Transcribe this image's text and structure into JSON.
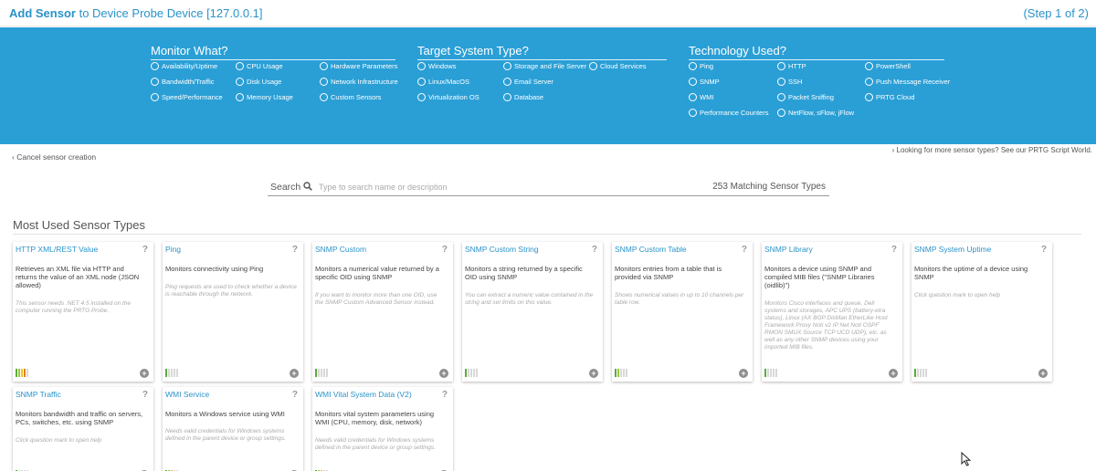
{
  "header": {
    "title_bold": "Add Sensor",
    "title_rest": "to Device",
    "device": "Probe Device [127.0.0.1]",
    "step": "(Step 1 of 2)"
  },
  "filters": {
    "monitor": {
      "title": "Monitor What?",
      "options": [
        "Availability/Uptime",
        "CPU Usage",
        "Hardware Parameters",
        "Bandwidth/Traffic",
        "Disk Usage",
        "Network Infrastructure",
        "Speed/Performance",
        "Memory Usage",
        "Custom Sensors"
      ]
    },
    "target": {
      "title": "Target System Type?",
      "options": [
        "Windows",
        "Storage and File Server",
        "Cloud Services",
        "Linux/MacOS",
        "Email Server",
        "Virtualization OS",
        "Database"
      ]
    },
    "technology": {
      "title": "Technology Used?",
      "options": [
        "Ping",
        "HTTP",
        "PowerShell",
        "SNMP",
        "SSH",
        "Push Message Receiver",
        "WMI",
        "Packet Sniffing",
        "PRTG Cloud",
        "Performance Counters",
        "NetFlow, sFlow, jFlow"
      ]
    }
  },
  "cancel_label": "Cancel sensor creation",
  "more_label": "Looking for more sensor types? See our PRTG Script World.",
  "search": {
    "label": "Search",
    "placeholder": "Type to search name or description",
    "count": "253",
    "count_label": "Matching Sensor Types"
  },
  "section_title": "Most Used Sensor Types",
  "cards": [
    {
      "name": "HTTP XML/REST Value",
      "desc": "Retrieves an XML file via HTTP and returns the value of an XML node (JSON allowed)",
      "note": "This sensor needs .NET 4.5 installed on the computer running the PRTG Probe.",
      "impact": 4
    },
    {
      "name": "Ping",
      "desc": "Monitors connectivity using Ping",
      "note": "Ping requests are used to check whether a device is reachable through the network.",
      "impact": 1
    },
    {
      "name": "SNMP Custom",
      "desc": "Monitors a numerical value returned by a specific OID using SNMP",
      "note": "If you want to monitor more than one OID, use the SNMP Custom Advanced Sensor instead.",
      "impact": 1
    },
    {
      "name": "SNMP Custom String",
      "desc": "Monitors a string returned by a specific OID using SNMP",
      "note": "You can extract a numeric value contained in the string and set limits on this value.",
      "impact": 1
    },
    {
      "name": "SNMP Custom Table",
      "desc": "Monitors entries from a table that is provided via SNMP",
      "note": "Shows numerical values in up to 10 channels per table row.",
      "impact": 2
    },
    {
      "name": "SNMP Library",
      "desc": "Monitors a device using SNMP and compiled MIB files (\"SNMP Libraries (oidlib)\")",
      "note": "Monitors Cisco interfaces and queue, Dell systems and storages, APC UPS (battery-etra status), Linux (AX BGP DisMan EtherLike Host Framework Proxy Noti v2 IP Net Noti OSPF RMON SMUX Source TCP UCD UDP), etc. as well as any other SNMP devices using your imported MIB files.",
      "impact": 1
    },
    {
      "name": "SNMP System Uptime",
      "desc": "Monitors the uptime of a device using SNMP",
      "note": "Click question mark to open help",
      "impact": 1
    },
    {
      "name": "SNMP Traffic",
      "desc": "Monitors bandwidth and traffic on servers, PCs, switches, etc. using SNMP",
      "note": "Click question mark to open help",
      "impact": 1
    },
    {
      "name": "WMI Service",
      "desc": "Monitors a Windows service using WMI",
      "note": "Needs valid credentials for Windows systems defined in the parent device or group settings.",
      "impact": 3
    },
    {
      "name": "WMI Vital System Data (V2)",
      "desc": "Monitors vital system parameters using WMI (CPU, memory, disk, network)",
      "note": "Needs valid credentials for Windows systems defined in the parent device or group settings.",
      "impact": 3
    }
  ],
  "colors": {
    "accent": "#2a9fd6",
    "link": "#2a93c9",
    "impact": [
      "#5aab3c",
      "#9bc63a",
      "#f0c419",
      "#e87d1e",
      "#d9261c"
    ],
    "impact_off": "#d8d8d8"
  }
}
